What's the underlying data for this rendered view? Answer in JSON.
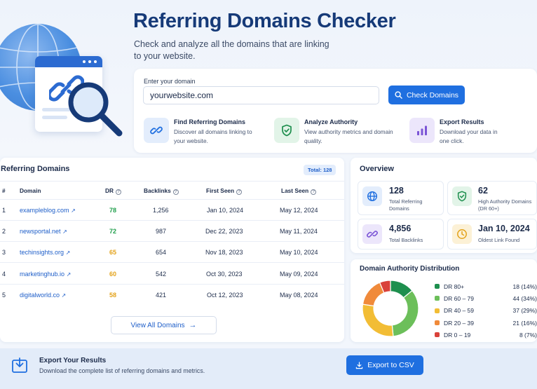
{
  "hero": {
    "title": "Referring Domains Checker",
    "subtitle": "Check and analyze all the domains that are linking to your website."
  },
  "search": {
    "label": "Enter your domain",
    "value": "yourwebsite.com",
    "button": "Check Domains"
  },
  "features": [
    {
      "title": "Find Referring Domains",
      "desc": "Discover all domains linking to your website.",
      "icon": "link-icon"
    },
    {
      "title": "Analyze Authority",
      "desc": "View authority metrics and domain quality.",
      "icon": "shield-check-icon"
    },
    {
      "title": "Export Results",
      "desc": "Download your data in one click.",
      "icon": "bar-chart-icon"
    }
  ],
  "table": {
    "title": "Referring Domains",
    "total_badge": "Total: 128",
    "headers": {
      "num": "#",
      "domain": "Domain",
      "dr": "DR",
      "backlinks": "Backlinks",
      "first_seen": "First Seen",
      "last_seen": "Last Seen"
    },
    "rows": [
      {
        "num": "1",
        "domain": "exampleblog.com",
        "dr": "78",
        "backlinks": "1,256",
        "first_seen": "Jan 10, 2024",
        "last_seen": "May 12, 2024"
      },
      {
        "num": "2",
        "domain": "newsportal.net",
        "dr": "72",
        "backlinks": "987",
        "first_seen": "Dec 22, 2023",
        "last_seen": "May 11, 2024"
      },
      {
        "num": "3",
        "domain": "techinsights.org",
        "dr": "65",
        "backlinks": "654",
        "first_seen": "Nov 18, 2023",
        "last_seen": "May 10, 2024"
      },
      {
        "num": "4",
        "domain": "marketinghub.io",
        "dr": "60",
        "backlinks": "542",
        "first_seen": "Oct 30, 2023",
        "last_seen": "May 09, 2024"
      },
      {
        "num": "5",
        "domain": "digitalworld.co",
        "dr": "58",
        "backlinks": "421",
        "first_seen": "Oct 12, 2023",
        "last_seen": "May 08, 2024"
      }
    ],
    "view_all": "View All Domains"
  },
  "overview": {
    "title": "Overview",
    "stats": [
      {
        "value": "128",
        "label": "Total Referring Domains",
        "icon": "globe-icon"
      },
      {
        "value": "62",
        "label": "High Authority Domains (DR 60+)",
        "icon": "shield-check-icon"
      },
      {
        "value": "4,856",
        "label": "Total Backlinks",
        "icon": "link-icon"
      },
      {
        "value": "Jan 10, 2024",
        "label": "Oldest Link Found",
        "icon": "clock-icon"
      }
    ]
  },
  "distribution": {
    "title": "Domain Authority Distribution",
    "items": [
      {
        "label": "DR 80+",
        "value": "18 (14%)",
        "count": 18,
        "color": "#1e8f4e"
      },
      {
        "label": "DR 60 – 79",
        "value": "44 (34%)",
        "count": 44,
        "color": "#6cbf5a"
      },
      {
        "label": "DR 40 – 59",
        "value": "37 (29%)",
        "count": 37,
        "color": "#f2bd35"
      },
      {
        "label": "DR 20 – 39",
        "value": "21 (16%)",
        "count": 21,
        "color": "#f08a3a"
      },
      {
        "label": "DR 0 – 19",
        "value": "8 (7%)",
        "count": 8,
        "color": "#d9423a"
      }
    ]
  },
  "export": {
    "title": "Export Your Results",
    "desc": "Download the complete list of referring domains and metrics.",
    "button": "Export to CSV"
  },
  "colors": {
    "primary": "#1f6fe0",
    "dr_green": "#1e9e4a",
    "dr_orange": "#e3a21a"
  }
}
